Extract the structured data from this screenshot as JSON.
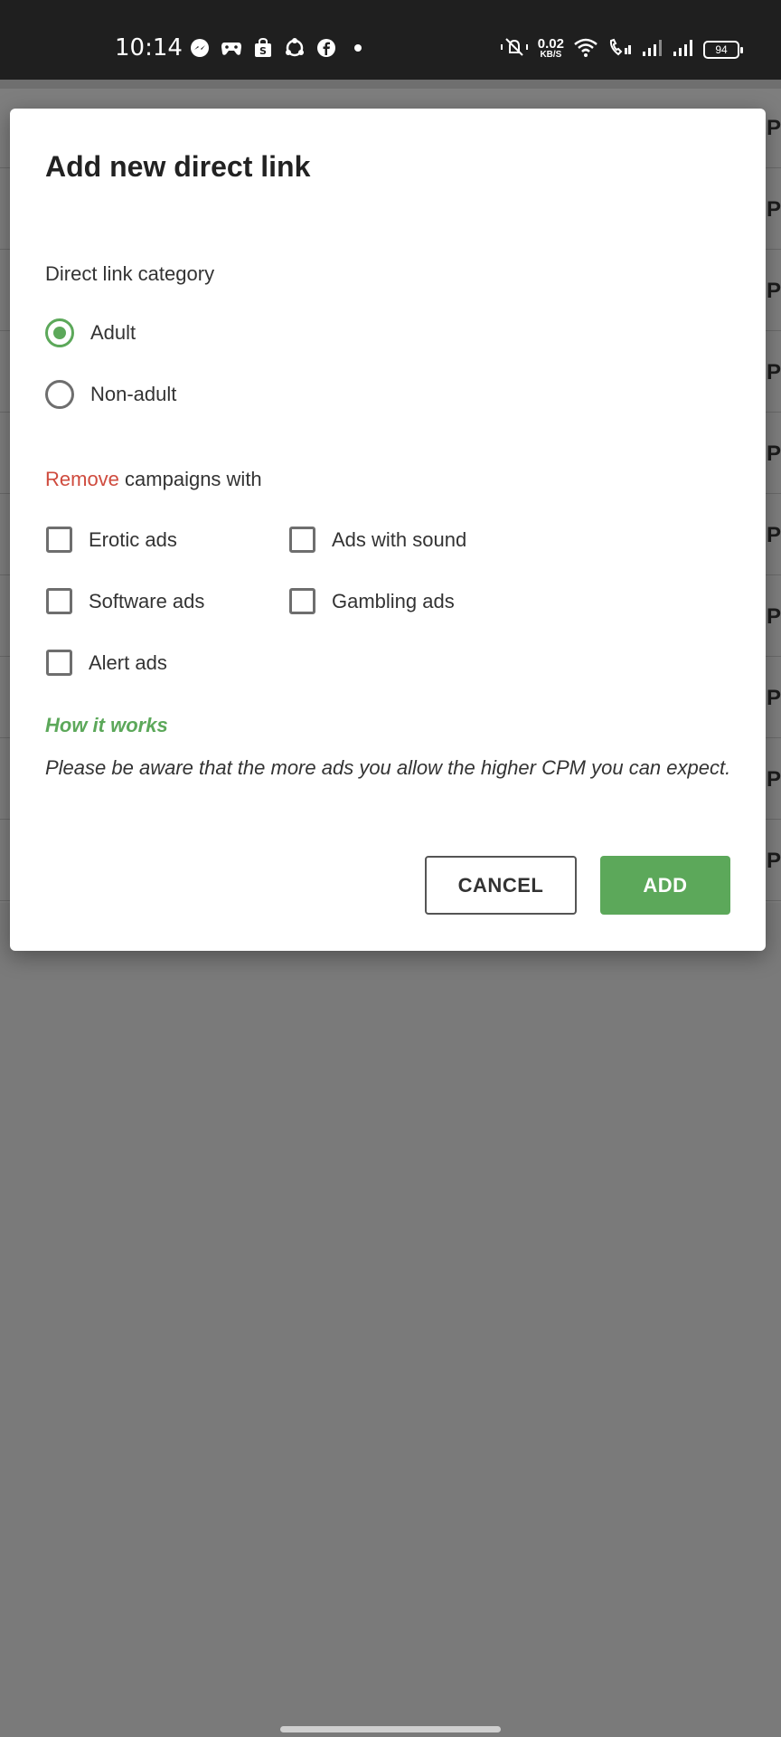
{
  "status_bar": {
    "time": "10:14",
    "notification_icons": [
      "messenger-icon",
      "gamepad-icon",
      "shop-icon",
      "share-icon",
      "facebook-icon",
      "dot-icon"
    ],
    "net_speed_value": "0.02",
    "net_speed_unit": "KB/S",
    "battery_level": "94"
  },
  "background": {
    "row_glyph": "PY"
  },
  "dialog": {
    "title": "Add new direct link",
    "category_label": "Direct link category",
    "category_options": [
      {
        "label": "Adult",
        "selected": true
      },
      {
        "label": "Non-adult",
        "selected": false
      }
    ],
    "remove_prefix": "Remove",
    "remove_suffix": " campaigns with",
    "ad_filters": [
      {
        "label": "Erotic ads",
        "checked": false
      },
      {
        "label": "Ads with sound",
        "checked": false
      },
      {
        "label": "Software ads",
        "checked": false
      },
      {
        "label": "Gambling ads",
        "checked": false
      },
      {
        "label": "Alert ads",
        "checked": false
      }
    ],
    "how_it_works": "How it works",
    "note": "Please be aware that the more ads you allow the higher CPM you can expect.",
    "cancel_label": "CANCEL",
    "add_label": "ADD"
  },
  "colors": {
    "accent_green": "#5ca85a",
    "remove_red": "#cf4b3e",
    "status_bar_bg": "#1f1f1f",
    "overlay_bg": "#7a7a7a"
  }
}
